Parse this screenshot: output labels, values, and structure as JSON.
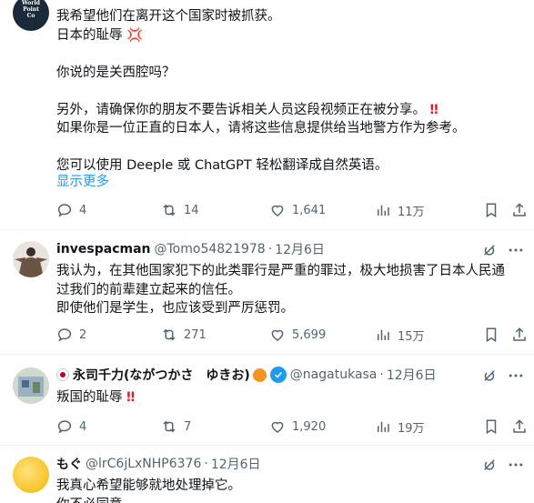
{
  "posts": [
    {
      "avatar_text": [
        "World",
        "Point",
        "Co"
      ],
      "lines": [
        "我希望他们在离开这个国家时被抓获。",
        "日本的耻辱",
        "",
        "你说的是关西腔吗？",
        "",
        "另外，请确保你的朋友不要告诉相关人员这段视频正在被分享。",
        "如果你是一位正直的日本人，请将这些信息提供给当地警方作为参考。",
        "",
        "您可以使用 Deeple 或 ChatGPT 轻松翻译成自然英语。"
      ],
      "anger_emoji": "💢",
      "exclaim": "‼",
      "show_more": "显示更多",
      "replies": "4",
      "reposts": "14",
      "likes": "1,641",
      "views": "11万"
    },
    {
      "name": "invespacman",
      "handle": "@Tomo54821978",
      "sep": "·",
      "date": "12月6日",
      "lines": [
        "我认为，在其他国家犯下的此类罪行是严重的罪过，极大地损害了日本人民通",
        "过我们的前辈建立起来的信任。",
        "即使他们是学生，也应该受到严厉惩罚。"
      ],
      "replies": "2",
      "reposts": "271",
      "likes": "5,699",
      "views": "15万"
    },
    {
      "name": "永司千力(ながつかさ　ゆきお)",
      "handle": "@nagatukasa",
      "sep": "·",
      "date": "12月6日",
      "lines": [
        "叛国的耻辱"
      ],
      "exclaim": "‼",
      "replies": "4",
      "reposts": "7",
      "likes": "1,920",
      "views": "19万"
    },
    {
      "name": "もぐ",
      "handle": "@lrC6jLxNHP6376",
      "sep": "·",
      "date": "12月6日",
      "lines": [
        "我真心希望能够就地处理掉它。",
        "你不必同意"
      ]
    }
  ],
  "colors": {
    "link": "#1d9bf0",
    "muted": "#536471",
    "text": "#0f1419",
    "red_exclaim": "#d81e2c",
    "verified": "#1d9bf0"
  },
  "icons": [
    "reply-icon",
    "repost-icon",
    "like-icon",
    "views-icon",
    "bookmark-icon",
    "share-icon",
    "grok-icon",
    "more-icon",
    "verified-badge-icon"
  ]
}
